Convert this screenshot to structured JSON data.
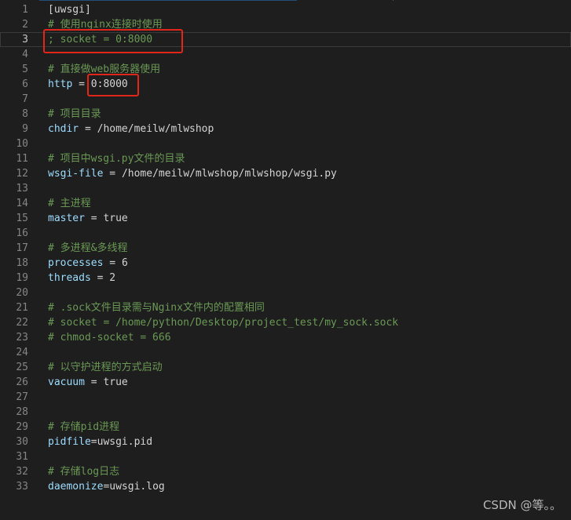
{
  "editor": {
    "lines": [
      {
        "num": "1",
        "parts": [
          {
            "t": "text",
            "v": "[uwsgi]"
          }
        ]
      },
      {
        "num": "2",
        "parts": [
          {
            "t": "comment",
            "v": "# 使用nginx连接时使用"
          }
        ]
      },
      {
        "num": "3",
        "parts": [
          {
            "t": "comment",
            "v": "; socket = 0:8000"
          }
        ]
      },
      {
        "num": "4",
        "parts": []
      },
      {
        "num": "5",
        "parts": [
          {
            "t": "comment",
            "v": "# 直接做web服务器使用"
          }
        ]
      },
      {
        "num": "6",
        "parts": [
          {
            "t": "key",
            "v": "http"
          },
          {
            "t": "op",
            "v": " = "
          },
          {
            "t": "val",
            "v": "0:8000"
          }
        ]
      },
      {
        "num": "7",
        "parts": []
      },
      {
        "num": "8",
        "parts": [
          {
            "t": "comment",
            "v": "# 项目目录"
          }
        ]
      },
      {
        "num": "9",
        "parts": [
          {
            "t": "key",
            "v": "chdir"
          },
          {
            "t": "op",
            "v": " = "
          },
          {
            "t": "val",
            "v": "/home/meilw/mlwshop"
          }
        ]
      },
      {
        "num": "10",
        "parts": []
      },
      {
        "num": "11",
        "parts": [
          {
            "t": "comment",
            "v": "# 项目中wsgi.py文件的目录"
          }
        ]
      },
      {
        "num": "12",
        "parts": [
          {
            "t": "key",
            "v": "wsgi-file"
          },
          {
            "t": "op",
            "v": " = "
          },
          {
            "t": "val",
            "v": "/home/meilw/mlwshop/mlwshop/wsgi.py"
          }
        ]
      },
      {
        "num": "13",
        "parts": []
      },
      {
        "num": "14",
        "parts": [
          {
            "t": "comment",
            "v": "# 主进程"
          }
        ]
      },
      {
        "num": "15",
        "parts": [
          {
            "t": "key",
            "v": "master"
          },
          {
            "t": "op",
            "v": " = "
          },
          {
            "t": "val",
            "v": "true"
          }
        ]
      },
      {
        "num": "16",
        "parts": []
      },
      {
        "num": "17",
        "parts": [
          {
            "t": "comment",
            "v": "# 多进程&多线程"
          }
        ]
      },
      {
        "num": "18",
        "parts": [
          {
            "t": "key",
            "v": "processes"
          },
          {
            "t": "op",
            "v": " = "
          },
          {
            "t": "val",
            "v": "6"
          }
        ]
      },
      {
        "num": "19",
        "parts": [
          {
            "t": "key",
            "v": "threads"
          },
          {
            "t": "op",
            "v": " = "
          },
          {
            "t": "val",
            "v": "2"
          }
        ]
      },
      {
        "num": "20",
        "parts": []
      },
      {
        "num": "21",
        "parts": [
          {
            "t": "comment",
            "v": "# .sock文件目录需与Nginx文件内的配置相同"
          }
        ]
      },
      {
        "num": "22",
        "parts": [
          {
            "t": "comment",
            "v": "# socket = /home/python/Desktop/project_test/my_sock.sock"
          }
        ]
      },
      {
        "num": "23",
        "parts": [
          {
            "t": "comment",
            "v": "# chmod-socket = 666"
          }
        ]
      },
      {
        "num": "24",
        "parts": []
      },
      {
        "num": "25",
        "parts": [
          {
            "t": "comment",
            "v": "# 以守护进程的方式启动"
          }
        ]
      },
      {
        "num": "26",
        "parts": [
          {
            "t": "key",
            "v": "vacuum"
          },
          {
            "t": "op",
            "v": " = "
          },
          {
            "t": "val",
            "v": "true"
          }
        ]
      },
      {
        "num": "27",
        "parts": []
      },
      {
        "num": "28",
        "parts": []
      },
      {
        "num": "29",
        "parts": [
          {
            "t": "comment",
            "v": "# 存储pid进程"
          }
        ]
      },
      {
        "num": "30",
        "parts": [
          {
            "t": "key",
            "v": "pidfile"
          },
          {
            "t": "op",
            "v": "="
          },
          {
            "t": "val",
            "v": "uwsgi.pid"
          }
        ]
      },
      {
        "num": "31",
        "parts": []
      },
      {
        "num": "32",
        "parts": [
          {
            "t": "comment",
            "v": "# 存储log日志"
          }
        ]
      },
      {
        "num": "33",
        "parts": [
          {
            "t": "key",
            "v": "daemonize"
          },
          {
            "t": "op",
            "v": "="
          },
          {
            "t": "val",
            "v": "uwsgi.log"
          }
        ]
      }
    ],
    "current_line": "3"
  },
  "watermark": "CSDN @等。。",
  "colors": {
    "background": "#1e1e1e",
    "comment": "#6a9955",
    "key": "#9cdcfe",
    "text": "#d4d4d4",
    "line_number": "#858585",
    "highlight_box": "#e0251b"
  }
}
